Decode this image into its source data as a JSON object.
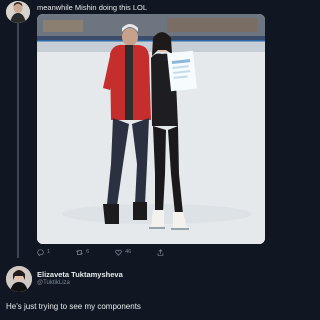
{
  "first_tweet": {
    "text": "meanwhile Mishin doing this LOL",
    "image_alt": "Coach and skater posing on an ice rink",
    "actions": {
      "reply_count": "1",
      "retweet_count": "6",
      "like_count": "46"
    }
  },
  "reply_tweet": {
    "name": "Elizaveta Tuktamysheva",
    "handle": "@TuktikLiza",
    "text": "He's just trying to see my components"
  },
  "colors": {
    "background": "#101722",
    "text": "#e8ecef",
    "muted": "#7b8794"
  }
}
